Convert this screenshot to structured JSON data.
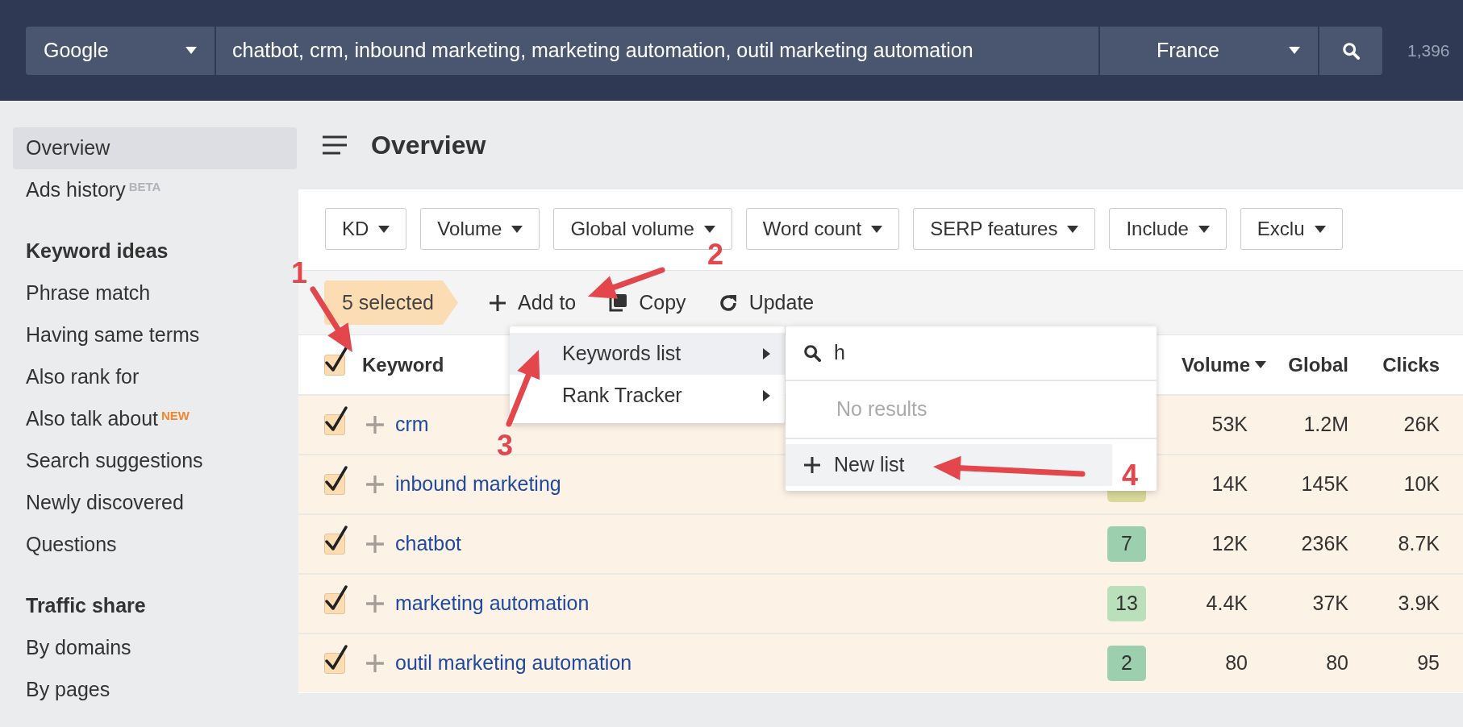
{
  "top_bar": {
    "engine": "Google",
    "keywords": "chatbot, crm, inbound marketing, marketing automation, outil marketing automation",
    "country": "France",
    "count": "1,396"
  },
  "sidebar": {
    "items": [
      {
        "kind": "item",
        "label": "Overview",
        "selected": true
      },
      {
        "kind": "item",
        "label": "Ads history",
        "tag": {
          "label": "BETA",
          "color": "#b0b3b9"
        },
        "selected": false
      },
      {
        "kind": "section",
        "label": "Keyword ideas"
      },
      {
        "kind": "item",
        "label": "Phrase match",
        "selected": false
      },
      {
        "kind": "item",
        "label": "Having same terms",
        "selected": false
      },
      {
        "kind": "item",
        "label": "Also rank for",
        "selected": false
      },
      {
        "kind": "item",
        "label": "Also talk about",
        "tag": {
          "label": "NEW",
          "color": "#f0892e"
        },
        "selected": false
      },
      {
        "kind": "item",
        "label": "Search suggestions",
        "selected": false
      },
      {
        "kind": "item",
        "label": "Newly discovered",
        "selected": false
      },
      {
        "kind": "item",
        "label": "Questions",
        "selected": false
      },
      {
        "kind": "section",
        "label": "Traffic share"
      },
      {
        "kind": "item",
        "label": "By domains",
        "selected": false
      },
      {
        "kind": "item",
        "label": "By pages",
        "selected": false
      }
    ]
  },
  "page_title": "Overview",
  "filters": [
    "KD",
    "Volume",
    "Global volume",
    "Word count",
    "SERP features",
    "Include",
    "Exclu"
  ],
  "toolbar": {
    "selection": "5 selected",
    "actions": [
      {
        "kind": "add",
        "label": "Add to"
      },
      {
        "kind": "copy",
        "label": "Copy"
      },
      {
        "kind": "update",
        "label": "Update"
      }
    ]
  },
  "table": {
    "header_checked": true,
    "columns": [
      "Keyword",
      "Volume",
      "Global",
      "Clicks"
    ],
    "rows": [
      {
        "checked": true,
        "keyword": "crm",
        "volume": "53K",
        "global": "1.2M",
        "clicks": "26K"
      },
      {
        "checked": true,
        "keyword": "inbound marketing",
        "kd": {
          "color": "#d9d99a"
        },
        "volume": "14K",
        "global": "145K",
        "clicks": "10K"
      },
      {
        "checked": true,
        "keyword": "chatbot",
        "kd": {
          "value": "7",
          "color": "#9bcfae"
        },
        "volume": "12K",
        "global": "236K",
        "clicks": "8.7K"
      },
      {
        "checked": true,
        "keyword": "marketing automation",
        "kd": {
          "value": "13",
          "color": "#b9dfbb"
        },
        "volume": "4.4K",
        "global": "37K",
        "clicks": "3.9K"
      },
      {
        "checked": true,
        "keyword": "outil marketing automation",
        "kd": {
          "value": "2",
          "color": "#9bcfae"
        },
        "volume": "80",
        "global": "80",
        "clicks": "95"
      }
    ]
  },
  "add_menu": {
    "items": [
      {
        "label": "Keywords list",
        "selected": true
      },
      {
        "label": "Rank Tracker",
        "selected": false
      }
    ]
  },
  "list_menu": {
    "search_value": "h",
    "empty_text": "No results",
    "new_list": {
      "label": "New list",
      "highlighted": true
    }
  },
  "annotations": [
    {
      "label": "1"
    },
    {
      "label": "2"
    },
    {
      "label": "3"
    },
    {
      "label": "4"
    }
  ]
}
